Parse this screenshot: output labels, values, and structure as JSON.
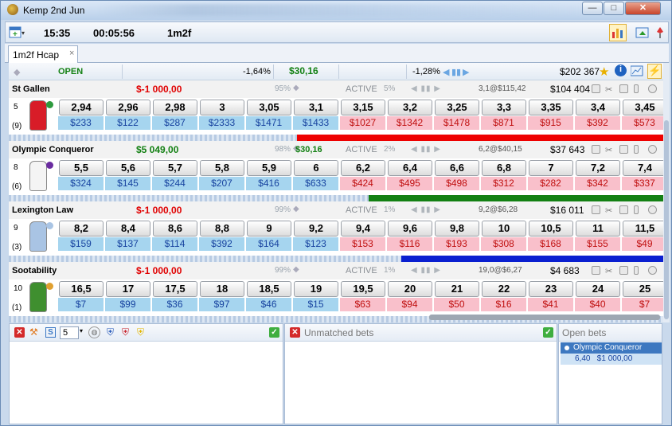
{
  "window": {
    "title": "Kemp  2nd Jun",
    "minimize": "—",
    "maximize": "□",
    "close": "✕"
  },
  "toolbar": {
    "clock": "15:35",
    "countdown": "00:05:56",
    "distance": "1m2f"
  },
  "tab": {
    "label": "1m2f Hcap",
    "close": "×"
  },
  "header": {
    "status": "OPEN",
    "back_pct": "-1,64%",
    "matched": "$30,16",
    "lay_pct": "-1,28%",
    "total": "$202 367"
  },
  "runners": [
    {
      "name": "St Gallen",
      "pl": "$-1 000,00",
      "pl_sign": "neg",
      "book_pct": "95%",
      "bet": "",
      "state": "ACTIVE",
      "lay_book_pct": "5%",
      "last": "3,1@$115,42",
      "volume": "$104 404",
      "cloth": "5",
      "stall": "(9)",
      "silk_color": "#d81c28",
      "cap_color": "#2e9a3e",
      "back": [
        {
          "price": "2,94",
          "amount": "$233"
        },
        {
          "price": "2,96",
          "amount": "$122"
        },
        {
          "price": "2,98",
          "amount": "$287"
        },
        {
          "price": "3",
          "amount": "$2333"
        },
        {
          "price": "3,05",
          "amount": "$1471"
        },
        {
          "price": "3,1",
          "amount": "$1433"
        }
      ],
      "lay": [
        {
          "price": "3,15",
          "amount": "$1027"
        },
        {
          "price": "3,2",
          "amount": "$1342"
        },
        {
          "price": "3,25",
          "amount": "$1478"
        },
        {
          "price": "3,3",
          "amount": "$871"
        },
        {
          "price": "3,35",
          "amount": "$915"
        },
        {
          "price": "3,4",
          "amount": "$392"
        },
        {
          "price": "3,45",
          "amount": "$573"
        }
      ],
      "bar_color": "#ee0000",
      "bar_level": 0.56
    },
    {
      "name": "Olympic Conqueror",
      "pl": "$5 049,00",
      "pl_sign": "pos",
      "book_pct": "98%",
      "bet": "$30,16",
      "state": "ACTIVE",
      "lay_book_pct": "2%",
      "last": "6,2@$40,15",
      "volume": "$37 643",
      "cloth": "8",
      "stall": "(6)",
      "silk_color": "#f4f4f4",
      "cap_color": "#6a2ca0",
      "back": [
        {
          "price": "5,5",
          "amount": "$324"
        },
        {
          "price": "5,6",
          "amount": "$145"
        },
        {
          "price": "5,7",
          "amount": "$244"
        },
        {
          "price": "5,8",
          "amount": "$207"
        },
        {
          "price": "5,9",
          "amount": "$416"
        },
        {
          "price": "6",
          "amount": "$633"
        }
      ],
      "lay": [
        {
          "price": "6,2",
          "amount": "$424"
        },
        {
          "price": "6,4",
          "amount": "$495"
        },
        {
          "price": "6,6",
          "amount": "$498"
        },
        {
          "price": "6,8",
          "amount": "$312"
        },
        {
          "price": "7",
          "amount": "$282"
        },
        {
          "price": "7,2",
          "amount": "$342"
        },
        {
          "price": "7,4",
          "amount": "$337"
        }
      ],
      "bar_color": "#138013",
      "bar_level": 0.45
    },
    {
      "name": "Lexington Law",
      "pl": "$-1 000,00",
      "pl_sign": "neg",
      "book_pct": "99%",
      "bet": "",
      "state": "ACTIVE",
      "lay_book_pct": "1%",
      "last": "9,2@$6,28",
      "volume": "$16 011",
      "cloth": "9",
      "stall": "(3)",
      "silk_color": "#a9c4e4",
      "cap_color": "#a9c4e4",
      "back": [
        {
          "price": "8,2",
          "amount": "$159"
        },
        {
          "price": "8,4",
          "amount": "$137"
        },
        {
          "price": "8,6",
          "amount": "$114"
        },
        {
          "price": "8,8",
          "amount": "$392"
        },
        {
          "price": "9",
          "amount": "$164"
        },
        {
          "price": "9,2",
          "amount": "$123"
        }
      ],
      "lay": [
        {
          "price": "9,4",
          "amount": "$153"
        },
        {
          "price": "9,6",
          "amount": "$116"
        },
        {
          "price": "9,8",
          "amount": "$193"
        },
        {
          "price": "10",
          "amount": "$308"
        },
        {
          "price": "10,5",
          "amount": "$168"
        },
        {
          "price": "11",
          "amount": "$155"
        },
        {
          "price": "11,5",
          "amount": "$49"
        }
      ],
      "bar_color": "#0a1fd0",
      "bar_level": 0.4
    },
    {
      "name": "Sootability",
      "pl": "$-1 000,00",
      "pl_sign": "neg",
      "book_pct": "99%",
      "bet": "",
      "state": "ACTIVE",
      "lay_book_pct": "1%",
      "last": "19,0@$6,27",
      "volume": "$4 683",
      "cloth": "10",
      "stall": "(1)",
      "silk_color": "#3f8f2f",
      "cap_color": "#e0a030",
      "back": [
        {
          "price": "16,5",
          "amount": "$7"
        },
        {
          "price": "17",
          "amount": "$99"
        },
        {
          "price": "17,5",
          "amount": "$36"
        },
        {
          "price": "18",
          "amount": "$97"
        },
        {
          "price": "18,5",
          "amount": "$46"
        },
        {
          "price": "19",
          "amount": "$15"
        }
      ],
      "lay": [
        {
          "price": "19,5",
          "amount": "$63"
        },
        {
          "price": "20",
          "amount": "$94"
        },
        {
          "price": "21",
          "amount": "$50"
        },
        {
          "price": "22",
          "amount": "$16"
        },
        {
          "price": "23",
          "amount": "$41"
        },
        {
          "price": "24",
          "amount": "$40"
        },
        {
          "price": "25",
          "amount": "$7"
        }
      ],
      "bar_color": "",
      "bar_level": 0
    }
  ],
  "bottom": {
    "stake_value": "5",
    "unmatched_label": "Unmatched bets",
    "open_label": "Open bets",
    "open_bet_name": "Olympic Conqueror",
    "open_bet_detail": "6,40   $1 000,00"
  },
  "icons": [
    "calendar-add-icon",
    "chart-icon",
    "export-icon",
    "pin-icon",
    "star-icon",
    "info-icon",
    "graph-icon",
    "lightning-icon",
    "delete-icon",
    "shield-icon"
  ]
}
